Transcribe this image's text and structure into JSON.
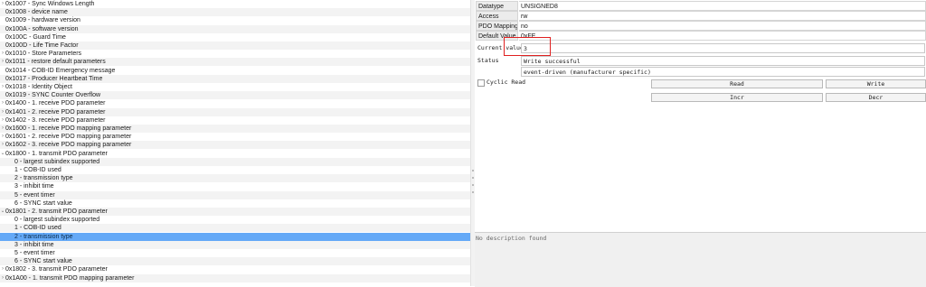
{
  "tree": {
    "rows": [
      {
        "label": "0x1007 - Sync Windows Length",
        "indent": 0,
        "arrow": "›",
        "selected": false
      },
      {
        "label": "0x1008 - device name",
        "indent": 0,
        "arrow": "",
        "selected": false
      },
      {
        "label": "0x1009 - hardware version",
        "indent": 0,
        "arrow": "",
        "selected": false
      },
      {
        "label": "0x100A - software version",
        "indent": 0,
        "arrow": "",
        "selected": false
      },
      {
        "label": "0x100C - Guard Time",
        "indent": 0,
        "arrow": "",
        "selected": false
      },
      {
        "label": "0x100D - Life Time Factor",
        "indent": 0,
        "arrow": "",
        "selected": false
      },
      {
        "label": "0x1010 - Store Parameters",
        "indent": 0,
        "arrow": "›",
        "selected": false
      },
      {
        "label": "0x1011 - restore default parameters",
        "indent": 0,
        "arrow": "›",
        "selected": false
      },
      {
        "label": "0x1014 - COB-ID Emergency message",
        "indent": 0,
        "arrow": "",
        "selected": false
      },
      {
        "label": "0x1017 - Producer Heartbeat Time",
        "indent": 0,
        "arrow": "",
        "selected": false
      },
      {
        "label": "0x1018 - Identity Object",
        "indent": 0,
        "arrow": "›",
        "selected": false
      },
      {
        "label": "0x1019 - SYNC Counter Overflow",
        "indent": 0,
        "arrow": "",
        "selected": false
      },
      {
        "label": "0x1400 - 1. receive PDO parameter",
        "indent": 0,
        "arrow": "›",
        "selected": false
      },
      {
        "label": "0x1401 - 2. receive PDO parameter",
        "indent": 0,
        "arrow": "›",
        "selected": false
      },
      {
        "label": "0x1402 - 3. receive PDO parameter",
        "indent": 0,
        "arrow": "›",
        "selected": false
      },
      {
        "label": "0x1600 - 1. receive PDO mapping parameter",
        "indent": 0,
        "arrow": "›",
        "selected": false
      },
      {
        "label": "0x1601 - 2. receive PDO mapping parameter",
        "indent": 0,
        "arrow": "›",
        "selected": false
      },
      {
        "label": "0x1602 - 3. receive PDO mapping parameter",
        "indent": 0,
        "arrow": "›",
        "selected": false
      },
      {
        "label": "0x1800 - 1. transmit PDO parameter",
        "indent": 0,
        "arrow": "⌄",
        "selected": false
      },
      {
        "label": "0 - largest subindex supported",
        "indent": 1,
        "arrow": "",
        "selected": false
      },
      {
        "label": "1 - COB-ID used",
        "indent": 1,
        "arrow": "",
        "selected": false
      },
      {
        "label": "2 - transmission type",
        "indent": 1,
        "arrow": "",
        "selected": false
      },
      {
        "label": "3 - inhibit time",
        "indent": 1,
        "arrow": "",
        "selected": false
      },
      {
        "label": "5 - event timer",
        "indent": 1,
        "arrow": "",
        "selected": false
      },
      {
        "label": "6 - SYNC start value",
        "indent": 1,
        "arrow": "",
        "selected": false
      },
      {
        "label": "0x1801 - 2. transmit PDO parameter",
        "indent": 0,
        "arrow": "⌄",
        "selected": false
      },
      {
        "label": "0 - largest subindex supported",
        "indent": 1,
        "arrow": "",
        "selected": false
      },
      {
        "label": "1 - COB-ID used",
        "indent": 1,
        "arrow": "",
        "selected": false
      },
      {
        "label": "2 - transmission type",
        "indent": 1,
        "arrow": "",
        "selected": true
      },
      {
        "label": "3 - inhibit time",
        "indent": 1,
        "arrow": "",
        "selected": false
      },
      {
        "label": "5 - event timer",
        "indent": 1,
        "arrow": "",
        "selected": false
      },
      {
        "label": "6 - SYNC start value",
        "indent": 1,
        "arrow": "",
        "selected": false
      },
      {
        "label": "0x1802 - 3. transmit PDO parameter",
        "indent": 0,
        "arrow": "›",
        "selected": false
      },
      {
        "label": "0x1A00 - 1. transmit PDO mapping parameter",
        "indent": 0,
        "arrow": "›",
        "selected": false
      }
    ]
  },
  "props": {
    "datatype_key": "Datatype",
    "datatype_val": "UNSIGNED8",
    "access_key": "Access",
    "access_val": "rw",
    "pdo_key": "PDO Mapping",
    "pdo_val": "no",
    "default_key": "Default Value",
    "default_val": "0xFE"
  },
  "editor": {
    "current_label": "Current value",
    "current_value": "3",
    "status_label": "Status",
    "status_line1": "Write successful",
    "status_line2": "event-driven (manufacturer specific)",
    "cyclic_label": "Cyclic Read",
    "read_label": "Read",
    "write_label": "Write",
    "incr_label": "Incr",
    "decr_label": "Decr"
  },
  "description": {
    "text": "No description found"
  },
  "colors": {
    "selection": "#64a9f7",
    "highlight_box": "#e02020"
  }
}
